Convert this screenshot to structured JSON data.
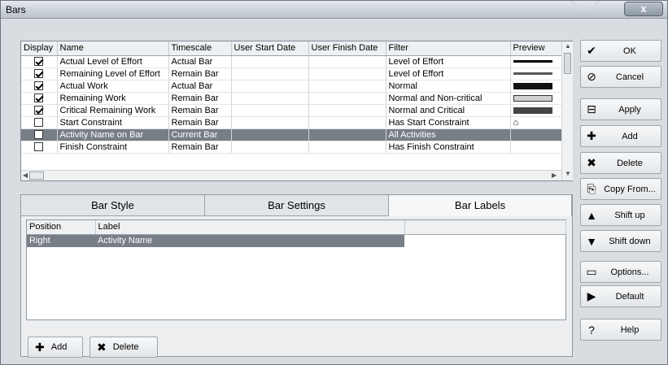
{
  "window": {
    "title": "Bars",
    "close_glyph": "x"
  },
  "grid": {
    "columns": [
      "Display",
      "Name",
      "Timescale",
      "User Start Date",
      "User Finish Date",
      "Filter",
      "Preview"
    ],
    "rows": [
      {
        "display": true,
        "name": "Actual Level of Effort",
        "timescale": "Actual Bar",
        "start": "",
        "finish": "",
        "filter": "Level of Effort",
        "preview": {
          "color": "#000000",
          "height": 3
        }
      },
      {
        "display": true,
        "name": "Remaining Level of Effort",
        "timescale": "Remain Bar",
        "start": "",
        "finish": "",
        "filter": "Level of Effort",
        "preview": {
          "color": "#555555",
          "height": 3
        }
      },
      {
        "display": true,
        "name": "Actual Work",
        "timescale": "Actual Bar",
        "start": "",
        "finish": "",
        "filter": "Normal",
        "preview": {
          "color": "#111111",
          "height": 8
        }
      },
      {
        "display": true,
        "name": "Remaining Work",
        "timescale": "Remain Bar",
        "start": "",
        "finish": "",
        "filter": "Normal and Non-critical",
        "preview": {
          "color": "#d0d0d0",
          "height": 8,
          "border": true
        }
      },
      {
        "display": true,
        "name": "Critical Remaining Work",
        "timescale": "Remain Bar",
        "start": "",
        "finish": "",
        "filter": "Normal and Critical",
        "preview": {
          "color": "#444444",
          "height": 8
        }
      },
      {
        "display": false,
        "name": "Start Constraint",
        "timescale": "Remain Bar",
        "start": "",
        "finish": "",
        "filter": "Has Start Constraint",
        "preview": {
          "symbol": "⌂"
        }
      },
      {
        "display": false,
        "name": "Activity Name on Bar",
        "timescale": "Current Bar",
        "start": "",
        "finish": "",
        "filter": "All Activities",
        "preview": {},
        "selected": true
      },
      {
        "display": false,
        "name": "Finish Constraint",
        "timescale": "Remain Bar",
        "start": "",
        "finish": "",
        "filter": "Has Finish Constraint",
        "preview": {}
      }
    ]
  },
  "buttons": [
    {
      "id": "ok",
      "label": "OK",
      "icon": "checkmark-icon",
      "glyph": "✔"
    },
    {
      "id": "cancel",
      "label": "Cancel",
      "icon": "no-entry-icon",
      "glyph": "⊘"
    },
    {
      "id": "apply",
      "label": "Apply",
      "icon": "apply-icon",
      "glyph": "⊟"
    },
    {
      "id": "add",
      "label": "Add",
      "icon": "plus-icon",
      "glyph": "✚"
    },
    {
      "id": "delete",
      "label": "Delete",
      "icon": "delete-x-icon",
      "glyph": "✖"
    },
    {
      "id": "copy-from",
      "label": "Copy From...",
      "icon": "copy-icon",
      "glyph": "⎘"
    },
    {
      "id": "shift-up",
      "label": "Shift up",
      "icon": "triangle-up-icon",
      "glyph": "▲"
    },
    {
      "id": "shift-down",
      "label": "Shift down",
      "icon": "triangle-down-icon",
      "glyph": "▼"
    },
    {
      "id": "options",
      "label": "Options...",
      "icon": "monitor-icon",
      "glyph": "▭"
    },
    {
      "id": "default",
      "label": "Default",
      "icon": "triangle-right-icon",
      "glyph": "▶"
    },
    {
      "id": "help",
      "label": "Help",
      "icon": "help-icon",
      "glyph": "?"
    }
  ],
  "tabs": [
    {
      "label": "Bar Style",
      "active": false
    },
    {
      "label": "Bar Settings",
      "active": false
    },
    {
      "label": "Bar Labels",
      "active": true
    }
  ],
  "labels": {
    "columns": [
      "Position",
      "Label"
    ],
    "rows": [
      {
        "position": "Right",
        "label": "Activity Name",
        "selected": true
      }
    ]
  },
  "bottom_buttons": {
    "add": "Add",
    "delete": "Delete"
  }
}
